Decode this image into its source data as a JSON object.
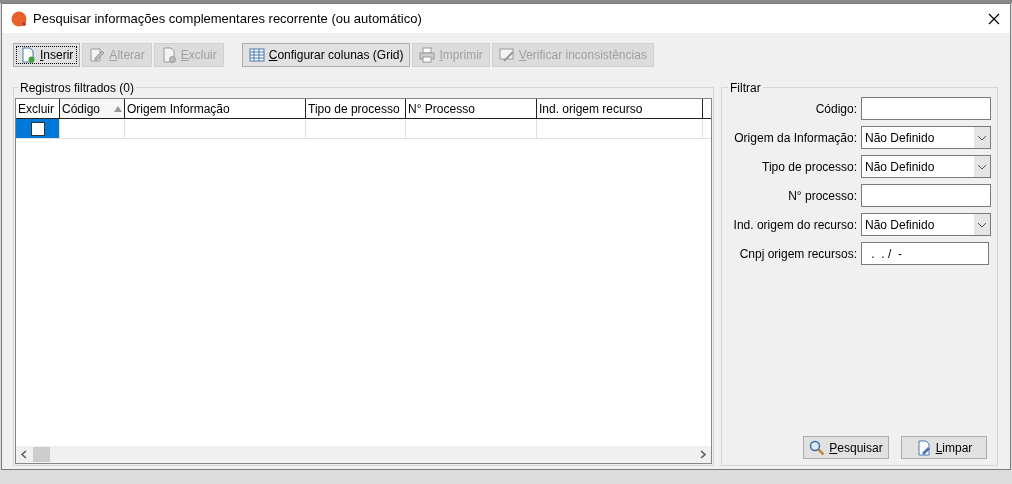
{
  "window": {
    "title": "Pesquisar informações complementares recorrente (ou automático)"
  },
  "toolbar": [
    {
      "label": "Inserir",
      "kind": "new",
      "disabled": false,
      "focused": true
    },
    {
      "label": "Alterar",
      "kind": "edit",
      "disabled": true,
      "focused": false
    },
    {
      "label": "Excluir",
      "kind": "delete",
      "disabled": true,
      "focused": false
    },
    {
      "label": "Configurar colunas (Grid)",
      "kind": "grid",
      "disabled": false,
      "focused": false
    },
    {
      "label": "Imprimir",
      "kind": "print",
      "disabled": true,
      "focused": false
    },
    {
      "label": "Verificar inconsistências",
      "kind": "check",
      "disabled": true,
      "focused": false
    }
  ],
  "records": {
    "title": "Registros filtrados (0)",
    "columns": [
      {
        "label": "Excluir",
        "sorted": false
      },
      {
        "label": "Código",
        "sorted": true
      },
      {
        "label": "Origem Informação",
        "sorted": false
      },
      {
        "label": "Tipo de processo",
        "sorted": false
      },
      {
        "label": "N° Processo",
        "sorted": false
      },
      {
        "label": "Ind. origem recurso",
        "sorted": false
      }
    ],
    "rows": [
      {
        "checked": false,
        "selected": true
      }
    ]
  },
  "filter": {
    "title": "Filtrar",
    "fields": [
      {
        "label": "Código:",
        "kind": "text"
      },
      {
        "label": "Origem da Informação:",
        "kind": "select",
        "value": "Não Definido"
      },
      {
        "label": "Tipo de processo:",
        "kind": "select",
        "value": "Não Definido"
      },
      {
        "label": "N° processo:",
        "kind": "text"
      },
      {
        "label": "Ind. origem do recurso:",
        "kind": "select",
        "value": "Não Definido"
      },
      {
        "label": "Cnpj origem recursos:",
        "kind": "mask",
        "value": " .  . /  -"
      }
    ],
    "buttons": [
      {
        "label": "Pesquisar",
        "kind": "search"
      },
      {
        "label": "Limpar",
        "kind": "clear"
      }
    ]
  }
}
